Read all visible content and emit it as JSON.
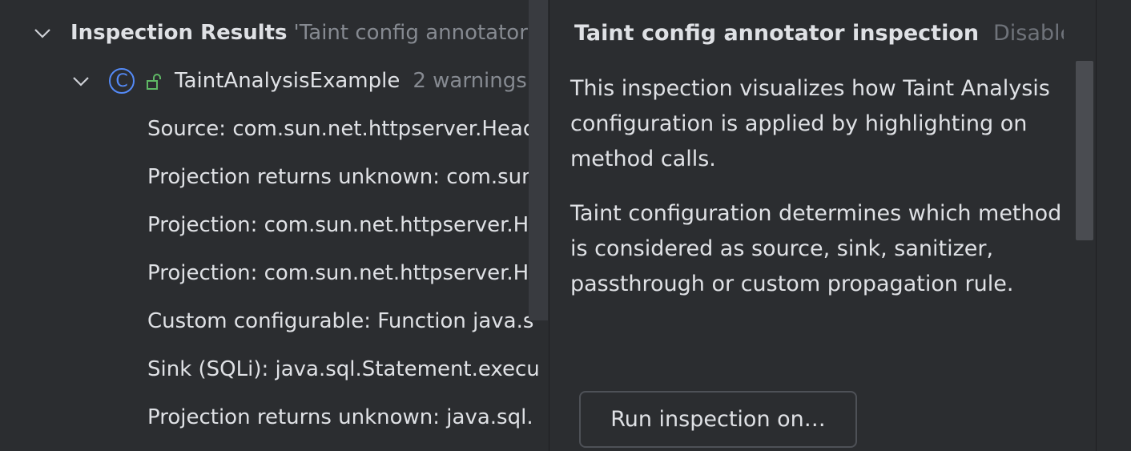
{
  "tree": {
    "root": {
      "label": "Inspection Results",
      "suffix": "'Taint config annotator'"
    },
    "class_node": {
      "icon_letter": "C",
      "label": "TaintAnalysisExample",
      "count": "2 warnings"
    },
    "items": [
      {
        "label": "Source: com.sun.net.httpserver.Head"
      },
      {
        "label": "Projection returns unknown: com.sun"
      },
      {
        "label": "Projection: com.sun.net.httpserver.H"
      },
      {
        "label": "Projection: com.sun.net.httpserver.H"
      },
      {
        "label": "Custom configurable: Function java.s"
      },
      {
        "label": "Sink (SQLi): java.sql.Statement.execu"
      },
      {
        "label": "Projection returns unknown: java.sql."
      }
    ]
  },
  "description": {
    "title": "Taint config annotator inspection",
    "disable_label": "Disable",
    "paragraphs": [
      "This inspection visualizes how Taint Analysis configuration is applied by highlighting on method calls.",
      "Taint configuration determines which method is considered as source, sink, sanitizer, passthrough or custom propagation rule."
    ],
    "run_button": "Run inspection on…"
  },
  "colors": {
    "background": "#2b2d30",
    "text": "#dfe1e5",
    "muted": "#868a91",
    "class_icon": "#548af7",
    "lock_icon": "#5fb865"
  }
}
